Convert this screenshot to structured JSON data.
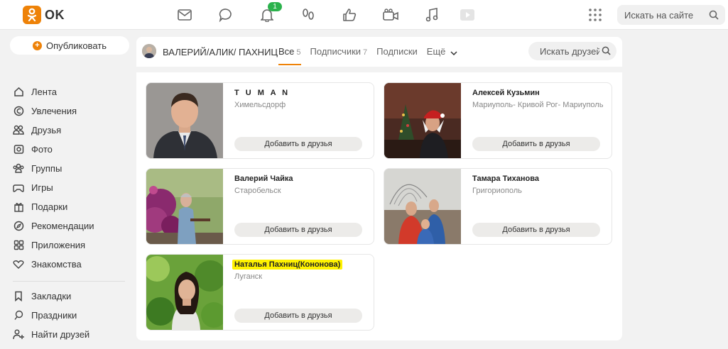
{
  "header": {
    "logo_text": "OK",
    "notification_count": "1",
    "search_placeholder": "Искать на сайте",
    "icons": [
      "mail-icon",
      "chat-icon",
      "bell-icon",
      "footprints-icon",
      "like-icon",
      "camera-icon",
      "music-icon",
      "video-icon",
      "apps-icon",
      "search-icon"
    ]
  },
  "sidebar": {
    "publish_label": "Опубликовать",
    "items": [
      {
        "label": "Лента",
        "icon": "home-icon"
      },
      {
        "label": "Увлечения",
        "icon": "hobby-icon"
      },
      {
        "label": "Друзья",
        "icon": "friends-icon"
      },
      {
        "label": "Фото",
        "icon": "photo-icon"
      },
      {
        "label": "Группы",
        "icon": "groups-icon"
      },
      {
        "label": "Игры",
        "icon": "gamepad-icon"
      },
      {
        "label": "Подарки",
        "icon": "gift-icon"
      },
      {
        "label": "Рекомендации",
        "icon": "compass-icon"
      },
      {
        "label": "Приложения",
        "icon": "apps-icon"
      },
      {
        "label": "Знакомства",
        "icon": "hearts-icon"
      }
    ],
    "items2": [
      {
        "label": "Закладки",
        "icon": "bookmark-icon"
      },
      {
        "label": "Праздники",
        "icon": "balloon-icon"
      },
      {
        "label": "Найти друзей",
        "icon": "add-person-icon"
      }
    ]
  },
  "profile": {
    "name": "ВАЛЕРИЙ/АЛИК/ ПАХНИЦ",
    "tabs": [
      {
        "label": "Все",
        "count": "5",
        "active": true
      },
      {
        "label": "Подписчики",
        "count": "7"
      },
      {
        "label": "Подписки",
        "count": ""
      },
      {
        "label": "Ещё",
        "count": ""
      }
    ],
    "search_placeholder": "Искать друзей"
  },
  "friends": [
    {
      "name": "T U M A N",
      "city": "Химельсдорф",
      "button": "Добавить в друзья"
    },
    {
      "name": "Алексей Кузьмин",
      "city": "Мариуполь- Кривой Рог- Мариуполь",
      "button": "Добавить в друзья"
    },
    {
      "name": "Валерий Чайка",
      "city": "Старобельск",
      "button": "Добавить в друзья"
    },
    {
      "name": "Тамара Тиханова",
      "city": "Григориополь",
      "button": "Добавить в друзья"
    },
    {
      "name": "Наталья Пахниц(Кононова)",
      "city": "Луганск",
      "button": "Добавить в друзья",
      "highlight": "#fff200"
    }
  ],
  "colors": {
    "accent": "#ee8208",
    "badge": "#2bb24c",
    "highlight": "#fff200"
  }
}
